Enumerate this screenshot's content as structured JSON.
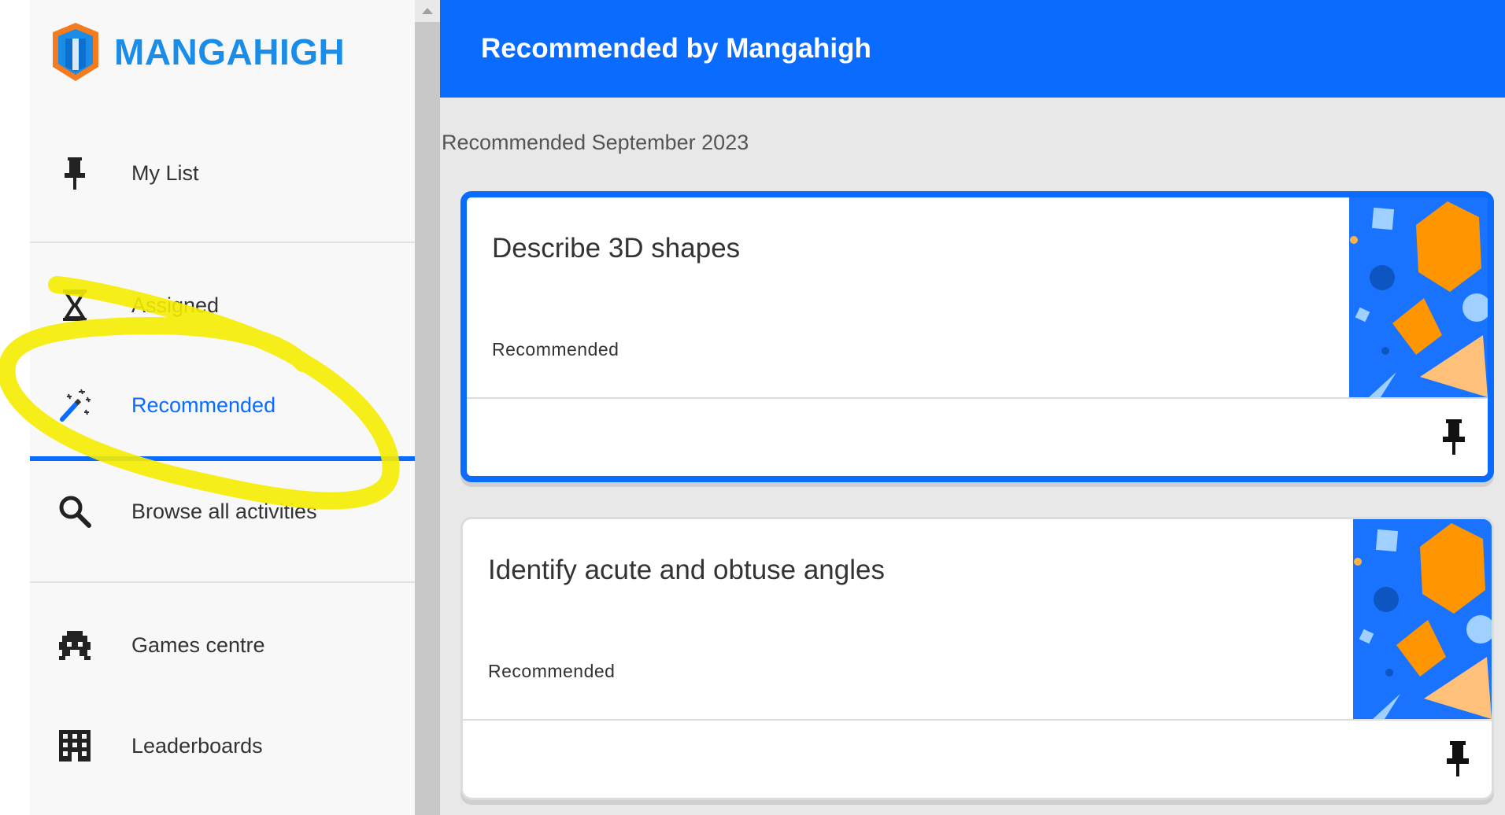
{
  "brand": {
    "name": "MANGAHIGH",
    "accent": "#0a6bff",
    "logo_orange": "#f47b20",
    "logo_blue": "#1a8de8"
  },
  "sidebar": {
    "items": [
      {
        "label": "My List",
        "icon": "pin-icon"
      },
      {
        "label": "Assigned",
        "icon": "hourglass-icon"
      },
      {
        "label": "Recommended",
        "icon": "magic-wand-icon",
        "active": true
      },
      {
        "label": "Browse all activities",
        "icon": "search-icon"
      },
      {
        "label": "Games centre",
        "icon": "space-invader-icon"
      },
      {
        "label": "Leaderboards",
        "icon": "building-icon"
      }
    ]
  },
  "header": {
    "title": "Recommended by Mangahigh"
  },
  "main": {
    "section_title": "Recommended September 2023",
    "cards": [
      {
        "title": "Describe 3D shapes",
        "status": "Recommended",
        "selected": true
      },
      {
        "title": "Identify acute and obtuse angles",
        "status": "Recommended",
        "selected": false
      }
    ]
  }
}
